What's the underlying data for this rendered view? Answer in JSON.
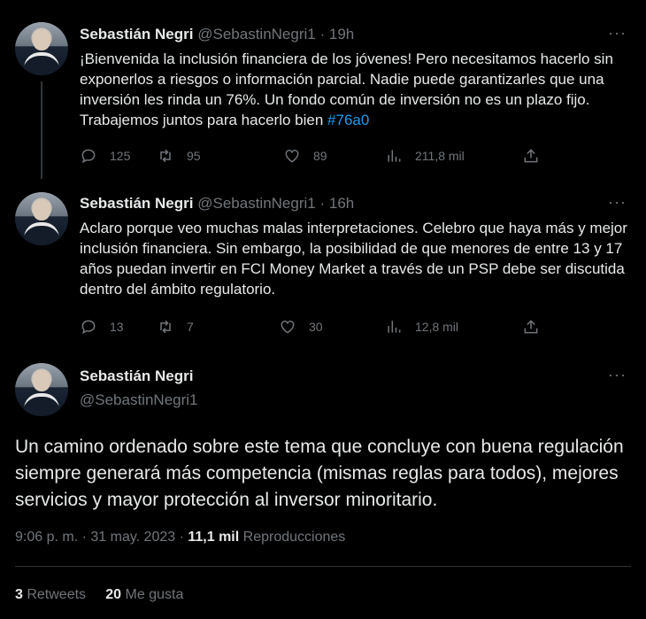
{
  "tweets": [
    {
      "name": "Sebastián Negri",
      "handle": "@SebastinNegri1",
      "separator": "·",
      "time": "19h",
      "more": "···",
      "text_main": "¡Bienvenida la inclusión financiera de los jóvenes! Pero necesitamos hacerlo sin exponerlos a riesgos o información parcial. Nadie puede garantizarles que una inversión les rinda un 76%. Un fondo común de inversión no es un plazo fijo. Trabajemos juntos para hacerlo bien ",
      "hashtag": "#76a0",
      "replies": "125",
      "retweets": "95",
      "likes": "89",
      "views": "211,8 mil"
    },
    {
      "name": "Sebastián Negri",
      "handle": "@SebastinNegri1",
      "separator": "·",
      "time": "16h",
      "more": "···",
      "text_main": "Aclaro porque veo muchas malas interpretaciones. Celebro que haya más y mejor inclusión financiera. Sin embargo, la posibilidad de que menores de entre 13 y 17 años puedan invertir en FCI Money Market a través de un PSP debe ser discutida dentro del ámbito regulatorio.",
      "replies": "13",
      "retweets": "7",
      "likes": "30",
      "views": "12,8 mil"
    }
  ],
  "main": {
    "name": "Sebastián Negri",
    "handle": "@SebastinNegri1",
    "more": "···",
    "text": "Un camino ordenado sobre este tema que concluye con buena regulación siempre generará más competencia (mismas reglas para todos), mejores servicios y mayor protección al inversor minoritario.",
    "time": "9:06 p. m. · 31 may. 2023 · ",
    "views_count": "11,1 mil",
    "views_label": " Reproducciones",
    "retweets_count": "3",
    "retweets_label": " Retweets",
    "likes_count": "20",
    "likes_label": " Me gusta"
  },
  "colors": {
    "background": "#000000",
    "text": "#e7e9ea",
    "muted": "#71767b",
    "link": "#1d9bf0"
  },
  "icons": [
    "reply-icon",
    "retweet-icon",
    "like-icon",
    "views-icon",
    "share-icon",
    "more-icon"
  ]
}
